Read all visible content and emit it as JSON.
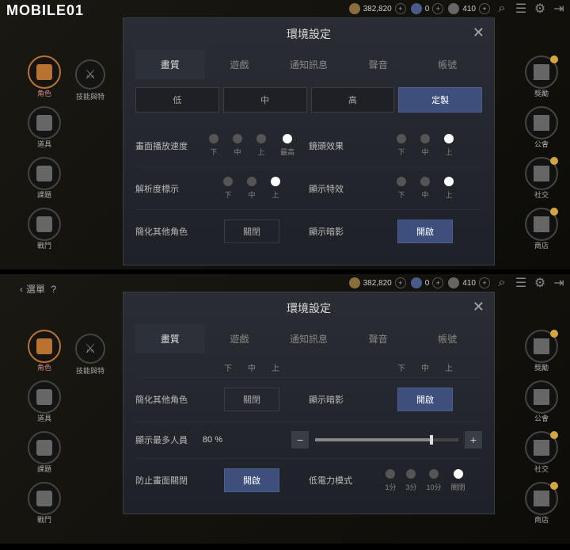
{
  "logo": "MOBILE01",
  "back_label": "選單",
  "currencies": {
    "gold": "382,820",
    "blue": "0",
    "gray": "410"
  },
  "left_menu": [
    {
      "label": "角色",
      "active": true
    },
    {
      "label": "道具",
      "active": false
    },
    {
      "label": "課題",
      "active": false
    },
    {
      "label": "戰鬥",
      "active": false
    }
  ],
  "skills_label": "技能與特",
  "right_menu": [
    "獎勵",
    "公會",
    "社交",
    "商店"
  ],
  "dialog": {
    "title": "環境設定",
    "tabs": [
      "畫質",
      "遊戲",
      "通知訊息",
      "聲音",
      "帳號"
    ],
    "quality_levels": [
      "低",
      "中",
      "高",
      "定製"
    ],
    "quality_selected": 3
  },
  "top": {
    "row1": {
      "left_label": "畫面播放速度",
      "left_opts": [
        "下",
        "中",
        "上",
        "最高"
      ],
      "left_sel": 3,
      "right_label": "鏡頭效果",
      "right_opts": [
        "下",
        "中",
        "上"
      ],
      "right_sel": 2
    },
    "row2": {
      "left_label": "解析度標示",
      "left_opts": [
        "下",
        "中",
        "上"
      ],
      "left_sel": 2,
      "right_label": "顯示特效",
      "right_opts": [
        "下",
        "中",
        "上"
      ],
      "right_sel": 2
    },
    "row3": {
      "left_label": "簡化其他角色",
      "left_toggle": "關閉",
      "right_label": "顯示暗影",
      "right_toggle": "開啟"
    }
  },
  "bottom": {
    "header_opts": [
      "下",
      "中",
      "上"
    ],
    "row1": {
      "left_label": "簡化其他角色",
      "left_toggle": "關閉",
      "right_label": "顯示暗影",
      "right_toggle": "開啟"
    },
    "row2": {
      "left_label": "顯示最多人員",
      "slider_value": "80 %"
    },
    "row3": {
      "left_label": "防止畫面關閉",
      "left_toggle": "開啟",
      "right_label": "低電力模式",
      "right_opts": [
        "1分",
        "3分",
        "10分",
        "關閉"
      ],
      "right_sel": 3
    }
  }
}
